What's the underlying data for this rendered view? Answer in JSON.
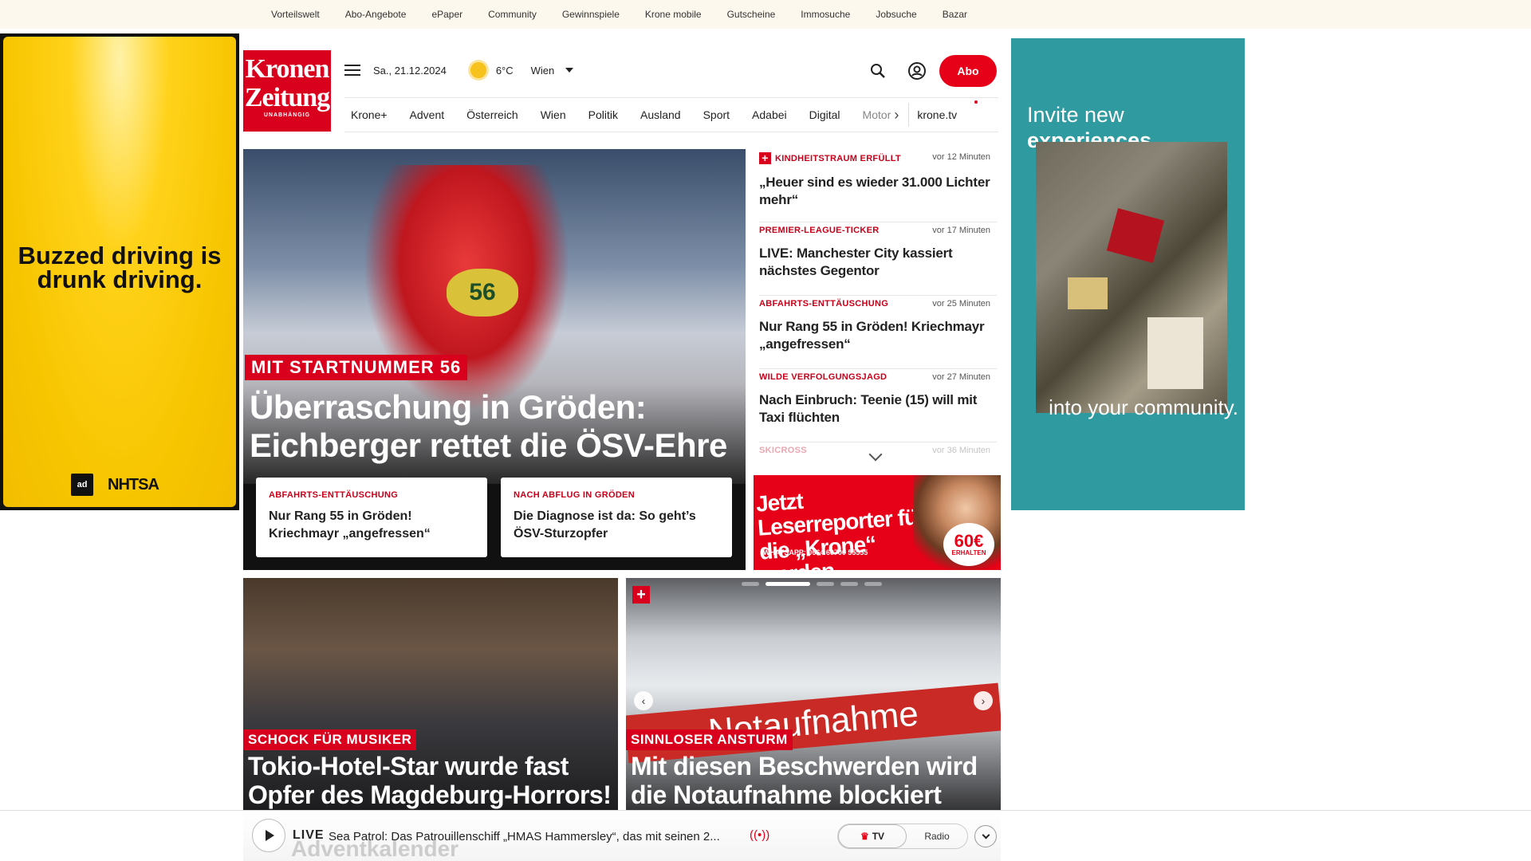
{
  "topbar": {
    "links": [
      "Vorteilswelt",
      "Abo-Angebote",
      "ePaper",
      "Community",
      "Gewinnspiele",
      "Krone mobile",
      "Gutscheine",
      "Immosuche",
      "Jobsuche",
      "Bazar"
    ]
  },
  "ad_left": {
    "headline": "Buzzed driving is drunk driving.",
    "logo_a": "ad",
    "logo_b": "NHTSA"
  },
  "ad_right": {
    "line1": "Invite new",
    "line1b": "experiences",
    "line2": "into your community."
  },
  "logo": {
    "line1": "Kronen",
    "line2": "Zeitung",
    "line3": "UNABHÄNGIG"
  },
  "header": {
    "date": "Sa., 21.12.2024",
    "temp": "6°C",
    "city": "Wien",
    "abo": "Abo"
  },
  "nav": {
    "items": [
      "Krone+",
      "Advent",
      "Österreich",
      "Wien",
      "Politik",
      "Ausland",
      "Sport",
      "Adabei",
      "Digital"
    ],
    "faded": "Motor",
    "ktv": "krone.tv"
  },
  "hero": {
    "bib": "56",
    "badge": "MIT STARTNUMMER 56",
    "title": "Überraschung in Gröden: Eichberger rettet die ÖSV-Ehre",
    "cards": [
      {
        "kicker": "ABFAHRTS-ENTTÄUSCHUNG",
        "text": "Nur Rang 55 in Gröden! Kriechmayr „angefressen“"
      },
      {
        "kicker": "NACH ABFLUG IN GRÖDEN",
        "text": "Die Diagnose ist da: So geht’s ÖSV-Sturzopfer"
      }
    ]
  },
  "list": {
    "items": [
      {
        "kicker": "KINDHEITSTRAUM ERFÜLLT",
        "time": "vor 12 Minuten",
        "text": "„Heuer sind es wieder 31.000 Lichter mehr“",
        "plus": "+"
      },
      {
        "kicker": "PREMIER-LEAGUE-TICKER",
        "time": "vor 17 Minuten",
        "text": "LIVE: Manchester City kassiert nächstes Gegentor"
      },
      {
        "kicker": "ABFAHRTS-ENTTÄUSCHUNG",
        "time": "vor 25 Minuten",
        "text": "Nur Rang 55 in Gröden! Kriechmayr „angefressen“"
      },
      {
        "kicker": "WILDE VERFOLGUNGSJAGD",
        "time": "vor 27 Minuten",
        "text": "Nach Einbruch: Teenie (15) will mit Taxi flüchten"
      }
    ],
    "faded": {
      "kicker": "SKICROSS",
      "time": "vor 36 Minuten"
    }
  },
  "promo": {
    "text": "Jetzt Leserreporter für die „Krone“ werden",
    "whatsapp": "WHATSAPP: 0664 60700 55555",
    "amount": "60€",
    "amount_sub": "ERHALTEN"
  },
  "tiles": [
    {
      "badge": "SCHOCK FÜR MUSIKER",
      "title": "Tokio-Hotel-Star wurde fast Opfer des Magdeburg-Horrors!"
    },
    {
      "badge": "SINNLOSER ANSTURM",
      "title": "Mit diesen Beschwerden wird die Notaufnahme blockiert",
      "sign": "Notaufnahme",
      "plus": "+"
    }
  ],
  "player": {
    "live": "LIVE",
    "title": "Sea Patrol: Das Patrouillenschiff „HMAS Hammersley“, das mit seinen 2...",
    "tv": "TV",
    "radio": "Radio",
    "ghost": "Adventkalender"
  }
}
